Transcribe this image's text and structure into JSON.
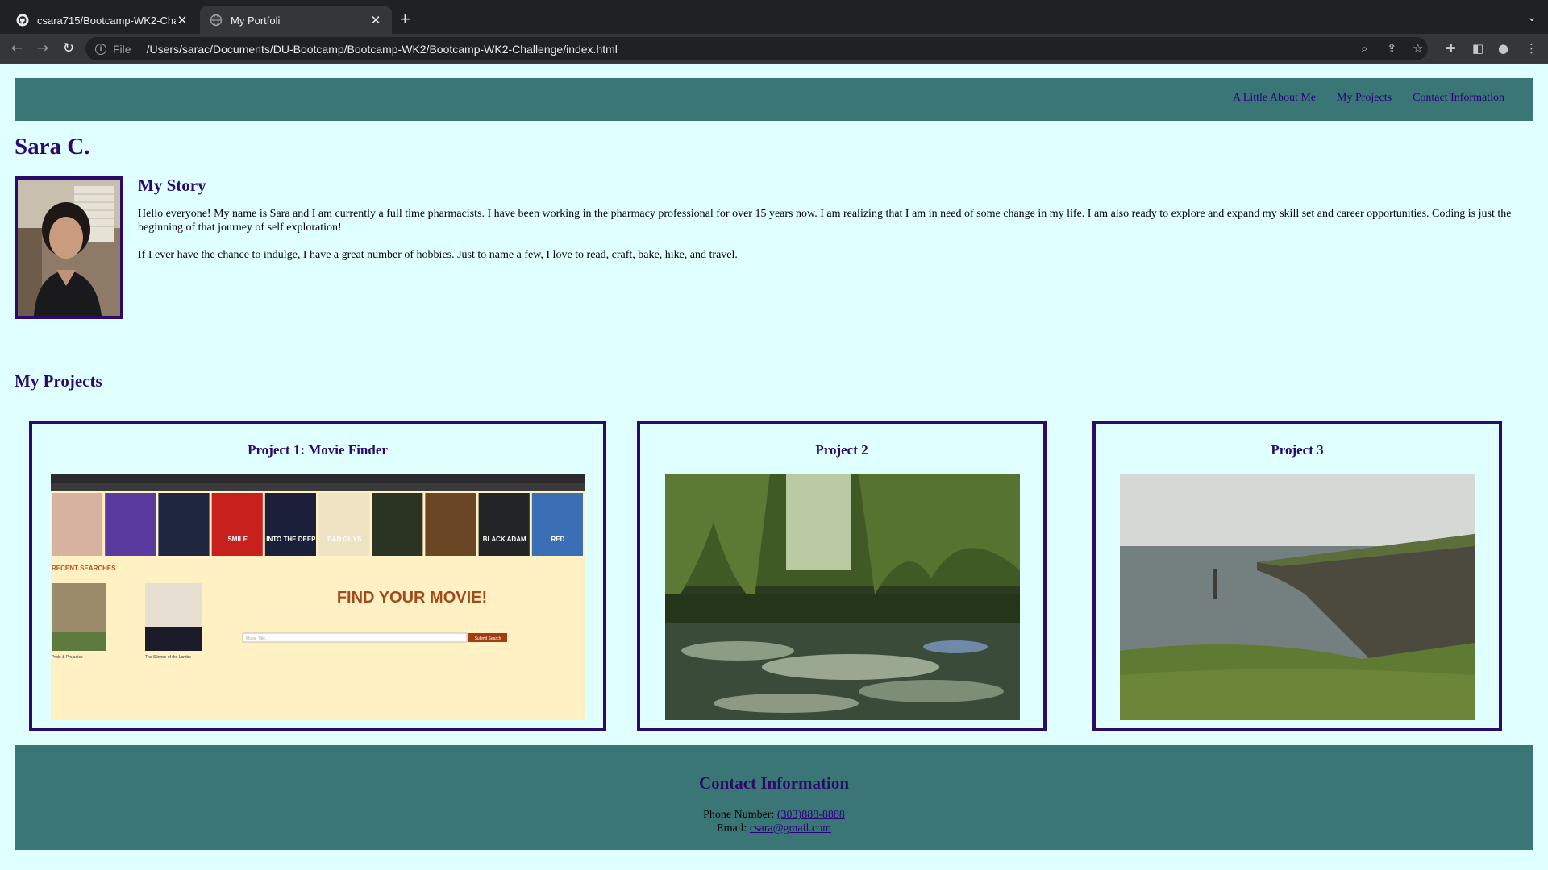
{
  "browser": {
    "tabs": [
      {
        "title": "csara715/Bootcamp-WK2-Chal",
        "icon": "github-icon"
      },
      {
        "title": "My Portfoli",
        "icon": "globe-icon",
        "active": true
      }
    ],
    "scheme_label": "File",
    "url": "/Users/sarac/Documents/DU-Bootcamp/Bootcamp-WK2/Bootcamp-WK2-Challenge/index.html"
  },
  "nav": {
    "links": [
      "A Little About Me",
      "My Projects",
      "Contact Information"
    ]
  },
  "profile": {
    "name": "Sara C."
  },
  "story": {
    "title": "My Story",
    "paragraphs": [
      "Hello everyone! My name is Sara and I am currently a full time pharmacists. I have been working in the pharmacy professional for over 15 years now. I am realizing that I am in need of some change in my life. I am also ready to explore and expand my skill set and career opportunities. Coding is just the beginning of that journey of self exploration!",
      "If I ever have the chance to indulge, I have a great number of hobbies. Just to name a few, I love to read, craft, bake, hike, and travel."
    ]
  },
  "projects": {
    "title": "My Projects",
    "items": [
      {
        "title": "Project 1: Movie Finder",
        "screenshot": {
          "recent_label": "RECENT SEARCHES",
          "headline": "FIND YOUR MOVIE!",
          "input_placeholder": "Movie Title...",
          "button_label": "Submit Search",
          "posters": [
            "",
            "",
            "",
            "SMILE",
            "INTO THE DEEP",
            "BAD GUYS",
            "",
            "",
            "BLACK ADAM",
            "RED"
          ],
          "recent": [
            {
              "title": "Pride & Prejudice"
            },
            {
              "title": "The Silence of the Lambs"
            }
          ]
        }
      },
      {
        "title": "Project 2"
      },
      {
        "title": "Project 3"
      }
    ]
  },
  "contact": {
    "title": "Contact Information",
    "phone_label": "Phone Number:",
    "phone": "(303)888-8888",
    "email_label": "Email:",
    "email": "csara@gmail.com"
  },
  "colors": {
    "page_bg": "#e0ffff",
    "header_bg": "#3b7676",
    "heading": "#2b0a6b",
    "link": "#2b0080"
  }
}
